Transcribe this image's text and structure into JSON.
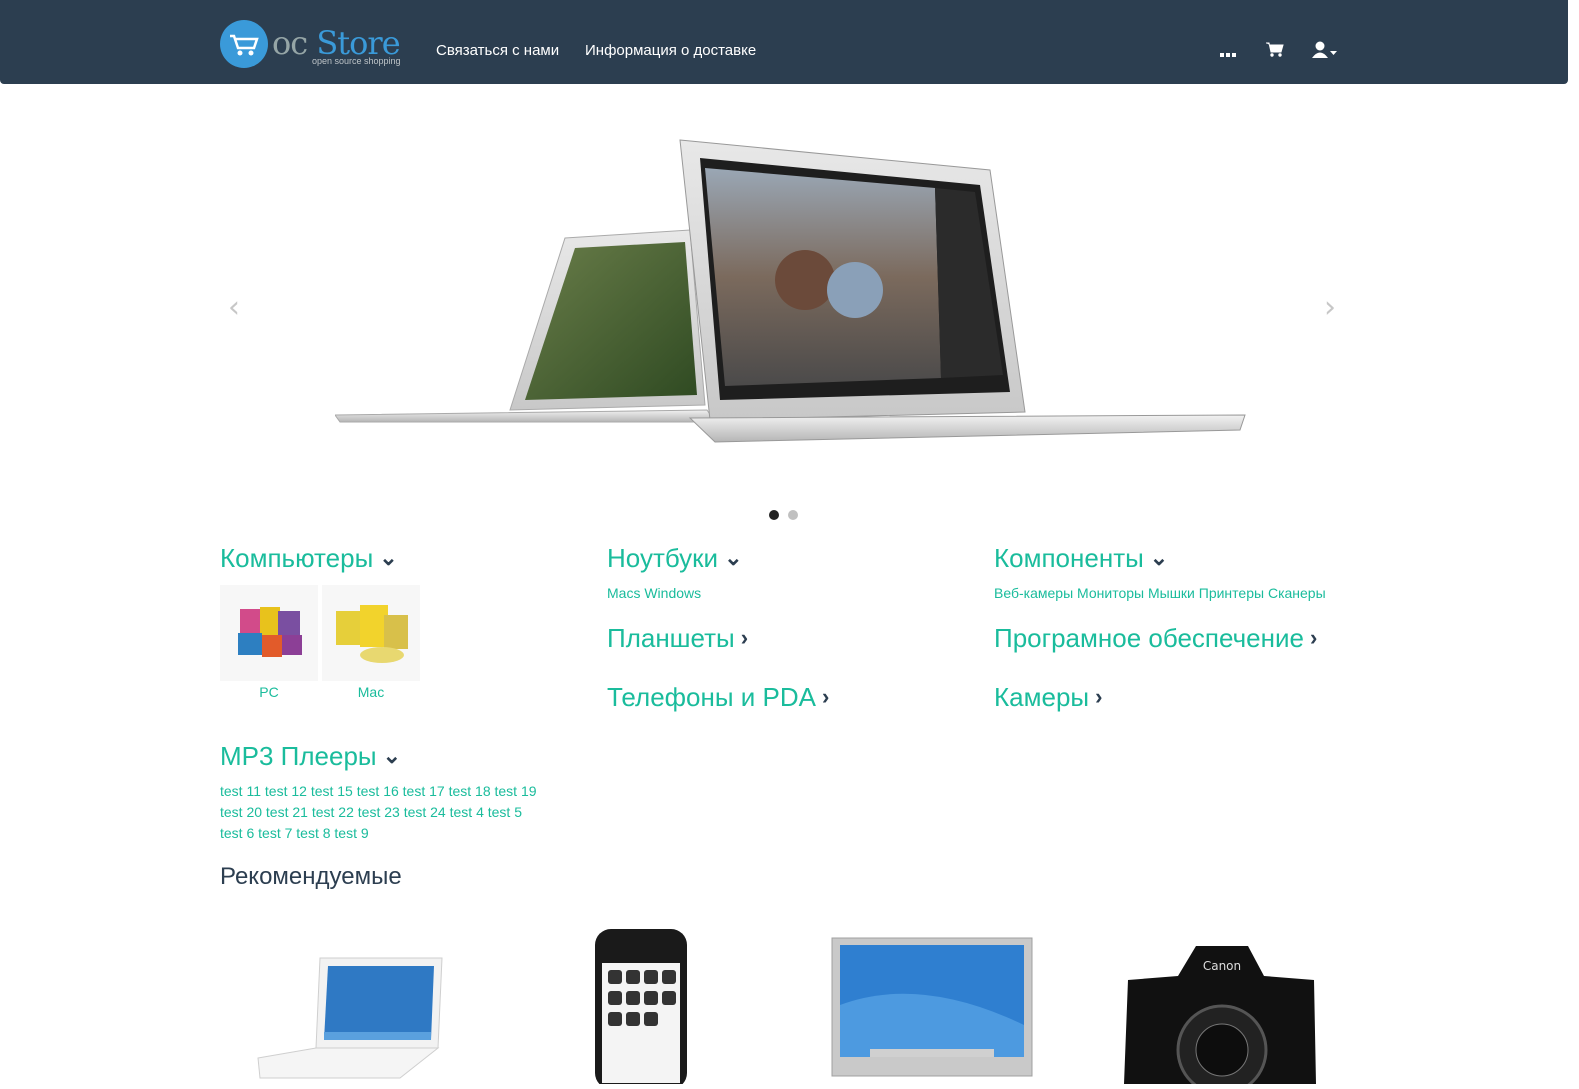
{
  "header": {
    "logo": {
      "main_oc": "oc",
      "main_store": "Store",
      "sub": "open source shopping"
    },
    "nav": [
      {
        "label": "Связаться с нами"
      },
      {
        "label": "Информация о доставке"
      }
    ],
    "icons": [
      "menu-dots-icon",
      "cart-icon",
      "user-icon"
    ]
  },
  "slider": {
    "active_slide": 1,
    "slide_count": 2,
    "colors": {
      "active_dot": "#222222",
      "inactive_dot": "#c0c0c0"
    }
  },
  "categories": {
    "computers": {
      "title": "Компьютеры",
      "items": [
        {
          "label": "PC"
        },
        {
          "label": "Mac"
        }
      ]
    },
    "laptops": {
      "title": "Ноутбуки",
      "items": [
        "Macs",
        "Windows"
      ]
    },
    "components": {
      "title": "Компоненты",
      "items": [
        "Веб-камеры",
        "Мониторы",
        "Мышки",
        "Принтеры",
        "Сканеры"
      ]
    },
    "tablets": {
      "title": "Планшеты"
    },
    "software": {
      "title": "Програмное обеспечение"
    },
    "phones": {
      "title": "Телефоны и PDA"
    },
    "cameras": {
      "title": "Камеры"
    },
    "mp3": {
      "title": "MP3 Плееры",
      "items": [
        "test 11",
        "test 12",
        "test 15",
        "test 16",
        "test 17",
        "test 18",
        "test 19",
        "test 20",
        "test 21",
        "test 22",
        "test 23",
        "test 24",
        "test 4",
        "test 5",
        "test 6",
        "test 7",
        "test 8",
        "test 9"
      ]
    }
  },
  "featured": {
    "title": "Рекомендуемые",
    "products": [
      {
        "icon": "macbook-image"
      },
      {
        "icon": "iphone-image"
      },
      {
        "icon": "cinema-display-image"
      },
      {
        "icon": "canon-camera-image"
      }
    ]
  },
  "colors": {
    "header_bg": "#2c3e50",
    "accent": "#1abc9c",
    "logo_blue": "#3a9ad9"
  }
}
